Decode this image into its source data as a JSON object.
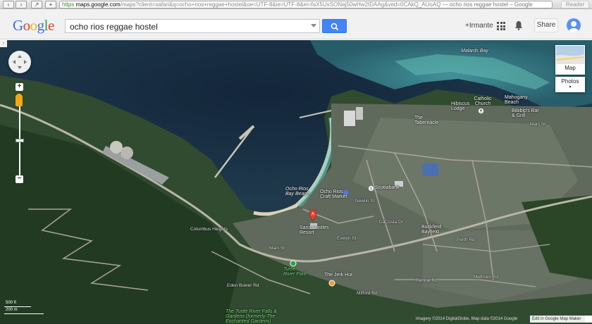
{
  "browser": {
    "back_icon": "chevron-left-icon",
    "forward_icon": "chevron-right-icon",
    "url_https": "https",
    "url_host": "maps.google.com",
    "url_rest": "/maps?client=safari&q=ocho+rios+reggae+hostel&oe=UTF-8&ie=UTF-8&ei=faX5UsSONaj50wHw2IDAAg&ved=0CAkQ_AUoAQ",
    "url_page_title": " — ocho rios reggae hostel – Google",
    "reader_label": "Reader"
  },
  "header": {
    "logo_letters": [
      "G",
      "o",
      "o",
      "g",
      "l",
      "e"
    ],
    "search_value": "ocho rios reggae hostel",
    "user_label": "+Irmante",
    "share_label": "Share"
  },
  "map_controls": {
    "zoom_in": "+",
    "zoom_out": "−",
    "layer_label": "Map",
    "photos_label": "Photos",
    "scale_ft": "500 ft",
    "scale_m": "200 m",
    "attribution": "Imagery ©2014 DigitalGlobe, Map data ©2014 Google",
    "edit_link": "Edit in Google Map Maker"
  },
  "map_labels": {
    "malards_bay": "Malards Bay",
    "mahogany_beach": "Mahogany Beach",
    "catholic_church": "Catholic Church",
    "hibiscus_lodge": "Hibiscus Lodge",
    "bibibips": "Bibibip's Bar & Grill",
    "the_tabernacle": "The Tabernacle",
    "main_st_east": "Main St",
    "ocho_rios_bay_beach": "Ocho Rios Bay Beach",
    "ocho_rios_craft_market": "Ocho Rios Craft Market",
    "newlin_st": "Newlin St",
    "scotiabank": "Scotiabank",
    "sand_castles_resort": "Sand Castles Resort",
    "main_st_west": "Main St",
    "columbus_heights": "Columbus Heights",
    "turtle_river_park": "Turtle River Park",
    "the_jerk_hut": "The Jerk Hut",
    "buckfield": "Buckfield Bayfield",
    "perth_rd": "Perth Rd",
    "methven_rd": "Methven Rd",
    "eden_bower_rd": "Eden Bower Rd",
    "turtle_river_falls": "The Turtle River Falls & Gardens (formerly The Enchanted Gardens)",
    "da_costa_dr": "DaCosta Dr",
    "milford_rd": "Milford Rd",
    "evelyn_st": "Evelyn St",
    "rennie_rd": "Rennie Rd"
  },
  "colors": {
    "search_blue": "#4285f4",
    "marker_red": "#e0412f",
    "sea_deep": "#1d3344",
    "reef_turquoise": "#3f8f9a"
  }
}
